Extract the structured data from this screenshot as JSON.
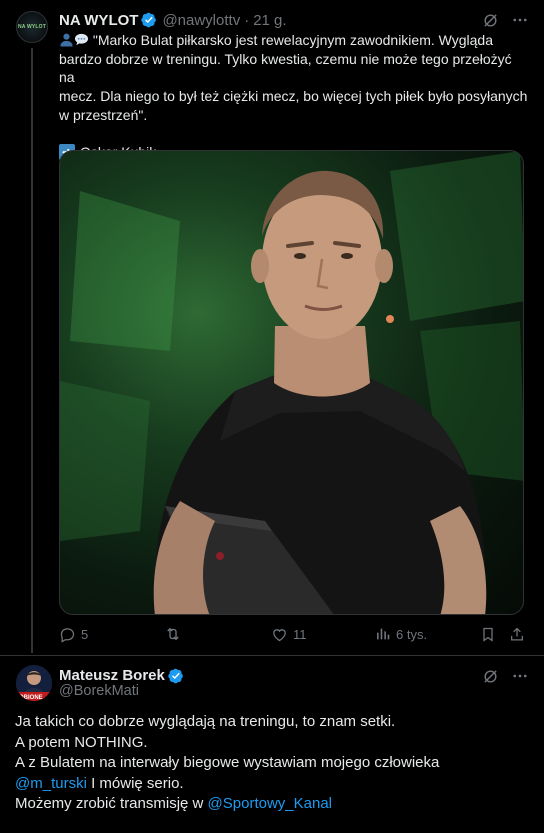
{
  "tweet1": {
    "avatar_text": "NA WYLOT",
    "display_name": "NA WYLOT",
    "handle": "@nawylottv",
    "separator": "·",
    "time": "21 g.",
    "body_line1": "\"Marko Bulat piłkarsko jest rewelacyjnym zawodnikiem. Wygląda",
    "body_line2": "bardzo dobrze w treningu. Tylko kwestia, czemu nie może tego przełożyć na",
    "body_line3": "mecz. Dla niego to był też ciężki mecz, bo więcej tych piłek było posyłanych",
    "body_line4": "w przestrzeń\".",
    "credit_name": "Oskar Kubik",
    "icons": {
      "lead": [
        "bust-in-silhouette-emoji",
        "speech-balloon-emoji"
      ],
      "credit": "right-arrow-emoji"
    },
    "actions": {
      "replies": "5",
      "reposts": "",
      "likes": "11",
      "views": "6 tys."
    }
  },
  "tweet2": {
    "display_name": "Mateusz Borek",
    "handle": "@BorekMati",
    "line1": "Ja takich co dobrze wyglądają na treningu, to znam setki.",
    "line2": "A potem NOTHING.",
    "line3": "A z Bulatem na interwały biegowe wystawiam mojego człowieka",
    "mention1": "@m_turski",
    "line4_rest": " I mówię serio.",
    "line5_pre": "Możemy zrobić transmisję w ",
    "mention2": "@Sportowy_Kanal"
  },
  "colors": {
    "background": "#000000",
    "text": "#e7e9ea",
    "secondary": "#71767b",
    "link": "#1d9bf0",
    "verified": "#1d9bf0"
  }
}
